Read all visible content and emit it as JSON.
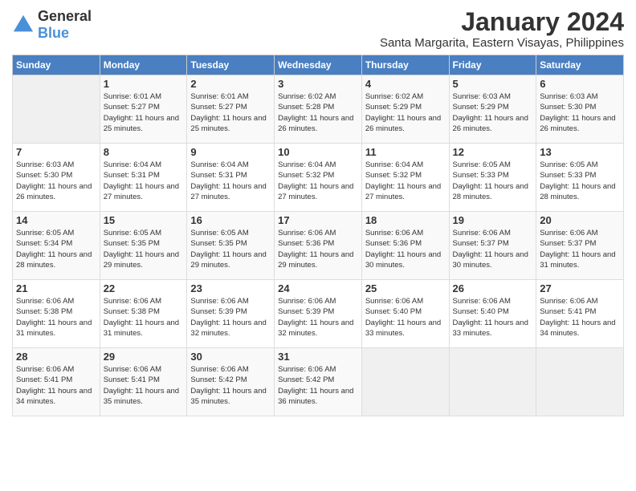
{
  "logo": {
    "general": "General",
    "blue": "Blue"
  },
  "title": "January 2024",
  "location": "Santa Margarita, Eastern Visayas, Philippines",
  "days_of_week": [
    "Sunday",
    "Monday",
    "Tuesday",
    "Wednesday",
    "Thursday",
    "Friday",
    "Saturday"
  ],
  "weeks": [
    [
      {
        "day": "",
        "sunrise": "",
        "sunset": "",
        "daylight": ""
      },
      {
        "day": "1",
        "sunrise": "Sunrise: 6:01 AM",
        "sunset": "Sunset: 5:27 PM",
        "daylight": "Daylight: 11 hours and 25 minutes."
      },
      {
        "day": "2",
        "sunrise": "Sunrise: 6:01 AM",
        "sunset": "Sunset: 5:27 PM",
        "daylight": "Daylight: 11 hours and 25 minutes."
      },
      {
        "day": "3",
        "sunrise": "Sunrise: 6:02 AM",
        "sunset": "Sunset: 5:28 PM",
        "daylight": "Daylight: 11 hours and 26 minutes."
      },
      {
        "day": "4",
        "sunrise": "Sunrise: 6:02 AM",
        "sunset": "Sunset: 5:29 PM",
        "daylight": "Daylight: 11 hours and 26 minutes."
      },
      {
        "day": "5",
        "sunrise": "Sunrise: 6:03 AM",
        "sunset": "Sunset: 5:29 PM",
        "daylight": "Daylight: 11 hours and 26 minutes."
      },
      {
        "day": "6",
        "sunrise": "Sunrise: 6:03 AM",
        "sunset": "Sunset: 5:30 PM",
        "daylight": "Daylight: 11 hours and 26 minutes."
      }
    ],
    [
      {
        "day": "7",
        "sunrise": "Sunrise: 6:03 AM",
        "sunset": "Sunset: 5:30 PM",
        "daylight": "Daylight: 11 hours and 26 minutes."
      },
      {
        "day": "8",
        "sunrise": "Sunrise: 6:04 AM",
        "sunset": "Sunset: 5:31 PM",
        "daylight": "Daylight: 11 hours and 27 minutes."
      },
      {
        "day": "9",
        "sunrise": "Sunrise: 6:04 AM",
        "sunset": "Sunset: 5:31 PM",
        "daylight": "Daylight: 11 hours and 27 minutes."
      },
      {
        "day": "10",
        "sunrise": "Sunrise: 6:04 AM",
        "sunset": "Sunset: 5:32 PM",
        "daylight": "Daylight: 11 hours and 27 minutes."
      },
      {
        "day": "11",
        "sunrise": "Sunrise: 6:04 AM",
        "sunset": "Sunset: 5:32 PM",
        "daylight": "Daylight: 11 hours and 27 minutes."
      },
      {
        "day": "12",
        "sunrise": "Sunrise: 6:05 AM",
        "sunset": "Sunset: 5:33 PM",
        "daylight": "Daylight: 11 hours and 28 minutes."
      },
      {
        "day": "13",
        "sunrise": "Sunrise: 6:05 AM",
        "sunset": "Sunset: 5:33 PM",
        "daylight": "Daylight: 11 hours and 28 minutes."
      }
    ],
    [
      {
        "day": "14",
        "sunrise": "Sunrise: 6:05 AM",
        "sunset": "Sunset: 5:34 PM",
        "daylight": "Daylight: 11 hours and 28 minutes."
      },
      {
        "day": "15",
        "sunrise": "Sunrise: 6:05 AM",
        "sunset": "Sunset: 5:35 PM",
        "daylight": "Daylight: 11 hours and 29 minutes."
      },
      {
        "day": "16",
        "sunrise": "Sunrise: 6:05 AM",
        "sunset": "Sunset: 5:35 PM",
        "daylight": "Daylight: 11 hours and 29 minutes."
      },
      {
        "day": "17",
        "sunrise": "Sunrise: 6:06 AM",
        "sunset": "Sunset: 5:36 PM",
        "daylight": "Daylight: 11 hours and 29 minutes."
      },
      {
        "day": "18",
        "sunrise": "Sunrise: 6:06 AM",
        "sunset": "Sunset: 5:36 PM",
        "daylight": "Daylight: 11 hours and 30 minutes."
      },
      {
        "day": "19",
        "sunrise": "Sunrise: 6:06 AM",
        "sunset": "Sunset: 5:37 PM",
        "daylight": "Daylight: 11 hours and 30 minutes."
      },
      {
        "day": "20",
        "sunrise": "Sunrise: 6:06 AM",
        "sunset": "Sunset: 5:37 PM",
        "daylight": "Daylight: 11 hours and 31 minutes."
      }
    ],
    [
      {
        "day": "21",
        "sunrise": "Sunrise: 6:06 AM",
        "sunset": "Sunset: 5:38 PM",
        "daylight": "Daylight: 11 hours and 31 minutes."
      },
      {
        "day": "22",
        "sunrise": "Sunrise: 6:06 AM",
        "sunset": "Sunset: 5:38 PM",
        "daylight": "Daylight: 11 hours and 31 minutes."
      },
      {
        "day": "23",
        "sunrise": "Sunrise: 6:06 AM",
        "sunset": "Sunset: 5:39 PM",
        "daylight": "Daylight: 11 hours and 32 minutes."
      },
      {
        "day": "24",
        "sunrise": "Sunrise: 6:06 AM",
        "sunset": "Sunset: 5:39 PM",
        "daylight": "Daylight: 11 hours and 32 minutes."
      },
      {
        "day": "25",
        "sunrise": "Sunrise: 6:06 AM",
        "sunset": "Sunset: 5:40 PM",
        "daylight": "Daylight: 11 hours and 33 minutes."
      },
      {
        "day": "26",
        "sunrise": "Sunrise: 6:06 AM",
        "sunset": "Sunset: 5:40 PM",
        "daylight": "Daylight: 11 hours and 33 minutes."
      },
      {
        "day": "27",
        "sunrise": "Sunrise: 6:06 AM",
        "sunset": "Sunset: 5:41 PM",
        "daylight": "Daylight: 11 hours and 34 minutes."
      }
    ],
    [
      {
        "day": "28",
        "sunrise": "Sunrise: 6:06 AM",
        "sunset": "Sunset: 5:41 PM",
        "daylight": "Daylight: 11 hours and 34 minutes."
      },
      {
        "day": "29",
        "sunrise": "Sunrise: 6:06 AM",
        "sunset": "Sunset: 5:41 PM",
        "daylight": "Daylight: 11 hours and 35 minutes."
      },
      {
        "day": "30",
        "sunrise": "Sunrise: 6:06 AM",
        "sunset": "Sunset: 5:42 PM",
        "daylight": "Daylight: 11 hours and 35 minutes."
      },
      {
        "day": "31",
        "sunrise": "Sunrise: 6:06 AM",
        "sunset": "Sunset: 5:42 PM",
        "daylight": "Daylight: 11 hours and 36 minutes."
      },
      {
        "day": "",
        "sunrise": "",
        "sunset": "",
        "daylight": ""
      },
      {
        "day": "",
        "sunrise": "",
        "sunset": "",
        "daylight": ""
      },
      {
        "day": "",
        "sunrise": "",
        "sunset": "",
        "daylight": ""
      }
    ]
  ]
}
